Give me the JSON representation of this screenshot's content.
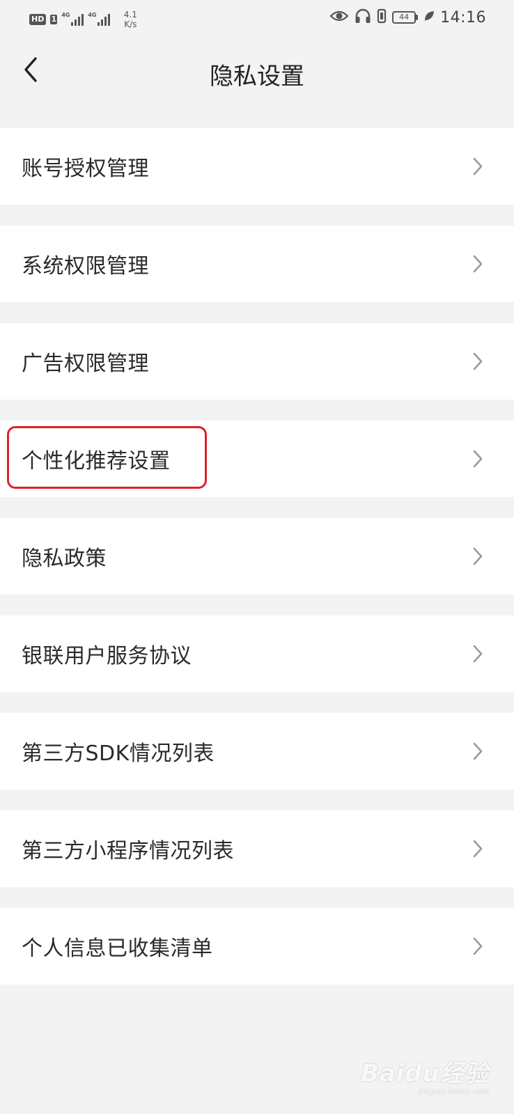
{
  "status_bar": {
    "hd_label": "HD",
    "sim_label": "1",
    "network1": "4G",
    "network2": "4G",
    "speed_value": "4.1",
    "speed_unit": "K/s",
    "battery_level": "44",
    "time": "14:16"
  },
  "header": {
    "title": "隐私设置"
  },
  "menu": {
    "items": [
      {
        "label": "账号授权管理"
      },
      {
        "label": "系统权限管理"
      },
      {
        "label": "广告权限管理"
      },
      {
        "label": "个性化推荐设置",
        "highlighted": true
      },
      {
        "label": "隐私政策"
      },
      {
        "label": "银联用户服务协议"
      },
      {
        "label": "第三方SDK情况列表"
      },
      {
        "label": "第三方小程序情况列表"
      },
      {
        "label": "个人信息已收集清单"
      }
    ]
  },
  "watermark": {
    "brand": "Baidu经验",
    "url": "jingyan.baidu.com"
  },
  "colors": {
    "background": "#f3f3f3",
    "item_background": "#ffffff",
    "highlight": "#e0202a",
    "chevron": "#9a9a9a"
  }
}
